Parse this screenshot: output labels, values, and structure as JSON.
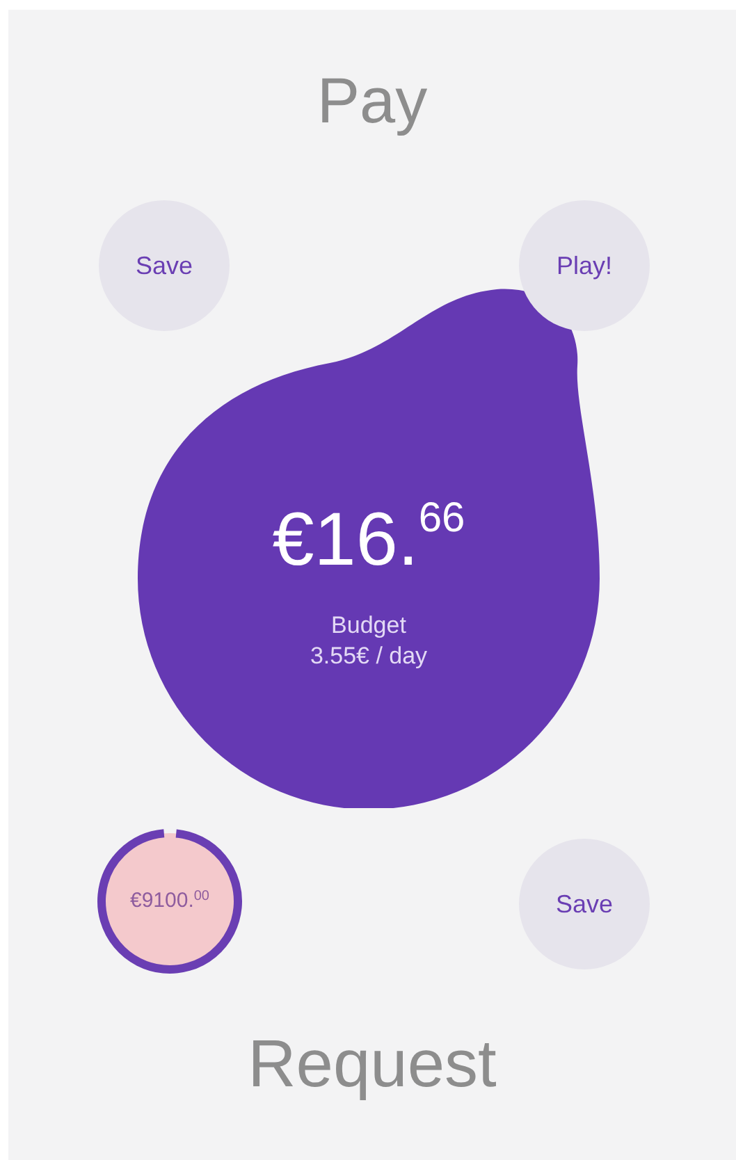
{
  "title": "Pay",
  "top_buttons": [
    {
      "label": "Save"
    },
    {
      "label": "Play!"
    }
  ],
  "balance": {
    "amount": "€16.$^{66}$",
    "label": "Budget",
    "rate": "3.55€ / day"
  },
  "goal": {
    "amount": "€9100.$^{00}$",
    "level": 0.97
  },
  "bottom_button": {
    "label": "Save"
  },
  "footer_action": "Request"
}
